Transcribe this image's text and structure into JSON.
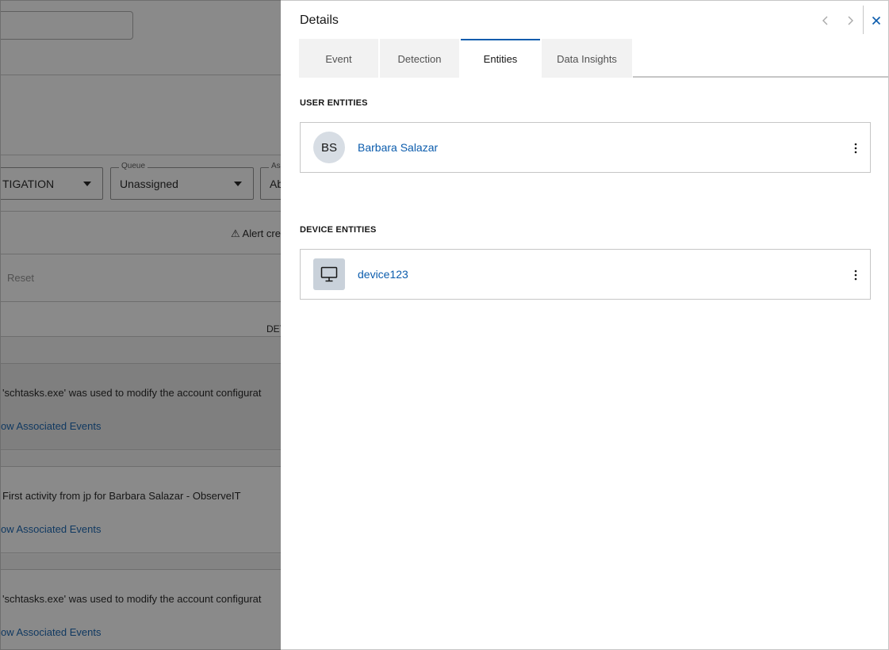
{
  "background": {
    "status_select": {
      "value": "TIGATION"
    },
    "queue_select": {
      "label": "Queue",
      "value": "Unassigned"
    },
    "assignee_select": {
      "label": "Ass",
      "value": "Ab"
    },
    "alert_text": "⚠ Alert cre",
    "reset_label": "Reset",
    "column_header": "DET",
    "rows": [
      {
        "description": "'schtasks.exe' was used to modify the account configurat",
        "link": "ow Associated Events"
      },
      {
        "description": "First activity from jp for Barbara Salazar - ObserveIT",
        "link": "ow Associated Events"
      },
      {
        "description": "'schtasks.exe' was used to modify the account configurat",
        "link": "ow Associated Events"
      }
    ]
  },
  "panel": {
    "title": "Details",
    "tabs": [
      {
        "label": "Event"
      },
      {
        "label": "Detection"
      },
      {
        "label": "Entities"
      },
      {
        "label": "Data Insights"
      }
    ],
    "active_tab": "Entities",
    "user_section": {
      "heading": "USER ENTITIES",
      "entities": [
        {
          "initials": "BS",
          "name": "Barbara Salazar"
        }
      ]
    },
    "device_section": {
      "heading": "DEVICE ENTITIES",
      "entities": [
        {
          "icon": "monitor-icon",
          "name": "device123"
        }
      ]
    }
  },
  "colors": {
    "link": "#0b5cad",
    "overlay": "rgba(22,22,22,0.5)",
    "tab_inactive": "#f2f2f2"
  }
}
